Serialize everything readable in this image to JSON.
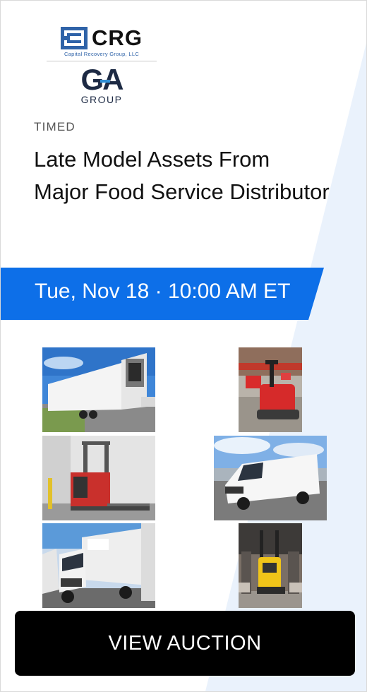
{
  "logos": {
    "crg_name": "CRG",
    "crg_tagline": "Capital Recovery Group, LLC",
    "ga_mark": "GA",
    "ga_group": "GROUP"
  },
  "auction": {
    "type": "TIMED",
    "title": "Late Model Assets From Major Food Service Distributor",
    "date": "Tue, Nov 18 · 10:00 AM ET",
    "cta_label": "VIEW AUCTION"
  },
  "photos": [
    {
      "name": "refrigerated-trailer-photo"
    },
    {
      "name": "pallet-jack-photo"
    },
    {
      "name": "reach-forklift-photo"
    },
    {
      "name": "cargo-van-photo"
    },
    {
      "name": "box-truck-photo"
    },
    {
      "name": "order-picker-photo"
    }
  ],
  "colors": {
    "accent_blue": "#0d6fe8",
    "stripe_blue": "#eaf2fc",
    "button_bg": "#000000",
    "crg_blue": "#2f63a8",
    "ga_navy": "#1d2a44"
  }
}
